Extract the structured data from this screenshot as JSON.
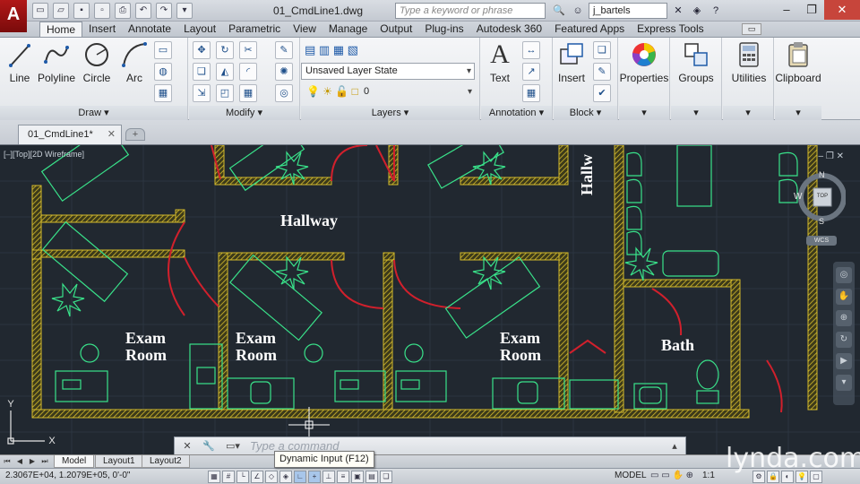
{
  "app": {
    "logo_letter": "A",
    "document_title": "01_CmdLine1.dwg",
    "search_placeholder": "Type a keyword or phrase",
    "user_name": "j_bartels"
  },
  "ribbon_tabs": [
    "Home",
    "Insert",
    "Annotate",
    "Layout",
    "Parametric",
    "View",
    "Manage",
    "Output",
    "Plug-ins",
    "Autodesk 360",
    "Featured Apps",
    "Express Tools"
  ],
  "active_tab": "Home",
  "panels": {
    "draw": {
      "title": "Draw",
      "tools": [
        "Line",
        "Polyline",
        "Circle",
        "Arc"
      ]
    },
    "modify": {
      "title": "Modify"
    },
    "layers": {
      "title": "Layers",
      "layer_state": "Unsaved Layer State",
      "current_layer": "0"
    },
    "annotation": {
      "title": "Annotation",
      "text_label": "Text"
    },
    "block": {
      "title": "Block",
      "insert_label": "Insert"
    },
    "properties": {
      "label": "Properties"
    },
    "groups": {
      "label": "Groups"
    },
    "utilities": {
      "label": "Utilities"
    },
    "clipboard": {
      "label": "Clipboard"
    }
  },
  "file_tab": {
    "label": "01_CmdLine1*"
  },
  "viewport_label": "[–][Top][2D Wireframe]",
  "rooms": {
    "hallway_main": "Hallway",
    "hallway_vertical": "Hallw",
    "exam1": "Exam\nRoom",
    "exam2": "Exam\nRoom",
    "exam3": "Exam\nRoom",
    "bath": "Bath"
  },
  "viewcube": {
    "top": "TOP",
    "north": "N",
    "south": "S",
    "west": "W",
    "wcs": "WCS"
  },
  "command_line": {
    "placeholder": "Type a command"
  },
  "layout_tabs": [
    "Model",
    "Layout1",
    "Layout2"
  ],
  "active_layout": "Model",
  "status": {
    "coordinates": "2.3067E+04, 1.2079E+05, 0'-0\"",
    "model": "MODEL",
    "scale": "1:1"
  },
  "tooltip": "Dynamic Input (F12)",
  "watermark": "lynda.com",
  "colors": {
    "accent_red": "#a31212",
    "wall_yellow": "#c9b027",
    "furniture_green": "#39e28a",
    "door_red": "#d1202c",
    "canvas_bg": "#212830"
  }
}
